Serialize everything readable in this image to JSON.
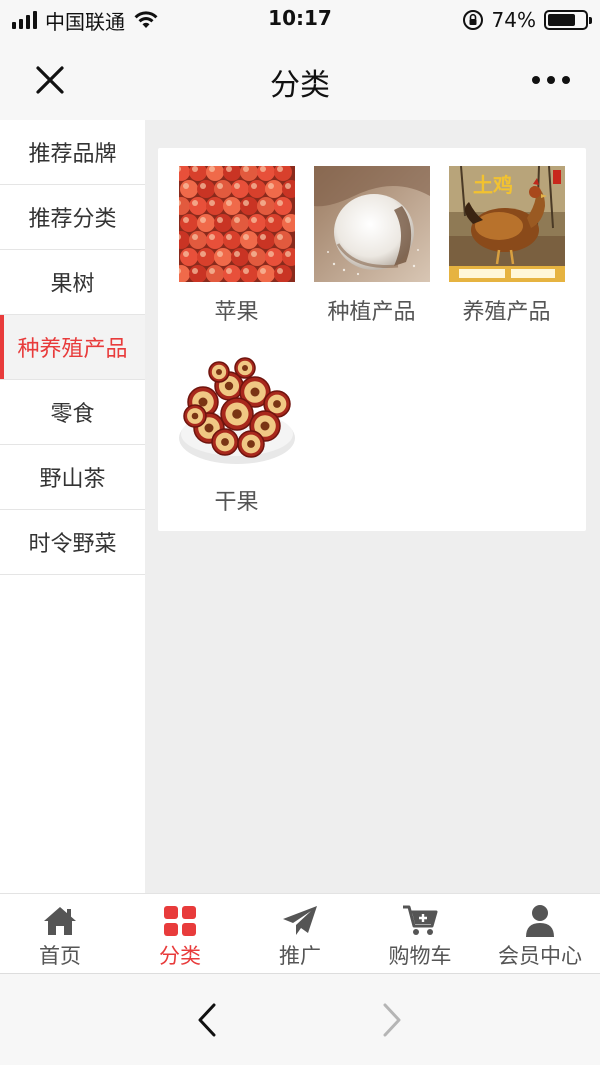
{
  "status_bar": {
    "carrier": "中国联通",
    "time": "10:17",
    "battery_percent": "74%",
    "battery_level": 0.74,
    "icons": [
      "signal-icon",
      "wifi-icon",
      "rotation-lock-icon",
      "battery-icon"
    ]
  },
  "nav": {
    "title": "分类",
    "close_icon": "close-icon",
    "more_icon": "more-dots-icon"
  },
  "sidebar": {
    "active_index": 3,
    "items": [
      {
        "label": "推荐品牌"
      },
      {
        "label": "推荐分类"
      },
      {
        "label": "果树"
      },
      {
        "label": "种养殖产品"
      },
      {
        "label": "零食"
      },
      {
        "label": "野山茶"
      },
      {
        "label": "时令野菜"
      }
    ]
  },
  "products": [
    {
      "label": "苹果",
      "image": "apples-photo"
    },
    {
      "label": "种植产品",
      "image": "rice-sack-photo"
    },
    {
      "label": "养殖产品",
      "image": "chicken-photo"
    },
    {
      "label": "干果",
      "image": "dried-jujube-photo"
    }
  ],
  "chicken_banner_text": "土鸡",
  "tabbar": {
    "active_index": 1,
    "items": [
      {
        "label": "首页",
        "icon": "home-icon"
      },
      {
        "label": "分类",
        "icon": "grid-icon"
      },
      {
        "label": "推广",
        "icon": "paper-plane-icon"
      },
      {
        "label": "购物车",
        "icon": "cart-icon"
      },
      {
        "label": "会员中心",
        "icon": "user-icon"
      }
    ]
  },
  "browser_bar": {
    "back_icon": "chevron-left-icon",
    "forward_icon": "chevron-right-icon"
  },
  "colors": {
    "accent": "#e83b3b",
    "background": "#eeeeee",
    "text": "#333333"
  }
}
